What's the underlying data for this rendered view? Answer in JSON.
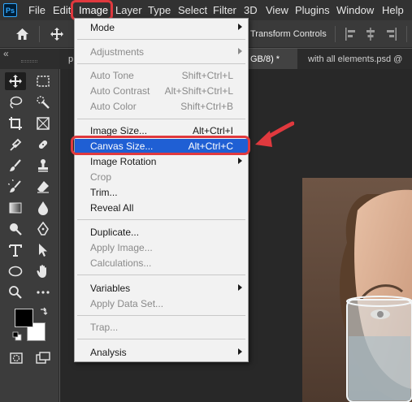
{
  "app": {
    "logo_text": "Ps"
  },
  "menubar": {
    "items": [
      "File",
      "Edit",
      "Image",
      "Layer",
      "Type",
      "Select",
      "Filter",
      "3D",
      "View",
      "Plugins",
      "Window",
      "Help"
    ],
    "active": "Image"
  },
  "options_bar": {
    "transform_label": "Transform Controls"
  },
  "tabs": [
    {
      "label": "p"
    },
    {
      "label": "GB/8) *"
    },
    {
      "label": "with all elements.psd @"
    }
  ],
  "toolbar": {
    "collapse_glyph": "«"
  },
  "image_menu": {
    "items": [
      {
        "label": "Mode",
        "shortcut": "",
        "submenu": true,
        "disabled": false
      },
      {
        "label": "Adjustments",
        "shortcut": "",
        "submenu": true,
        "disabled": true
      },
      {
        "label": "Auto Tone",
        "shortcut": "Shift+Ctrl+L",
        "submenu": false,
        "disabled": true
      },
      {
        "label": "Auto Contrast",
        "shortcut": "Alt+Shift+Ctrl+L",
        "submenu": false,
        "disabled": true
      },
      {
        "label": "Auto Color",
        "shortcut": "Shift+Ctrl+B",
        "submenu": false,
        "disabled": true
      },
      {
        "label": "Image Size...",
        "shortcut": "Alt+Ctrl+I",
        "submenu": false,
        "disabled": false
      },
      {
        "label": "Canvas Size...",
        "shortcut": "Alt+Ctrl+C",
        "submenu": false,
        "disabled": false,
        "highlighted": true
      },
      {
        "label": "Image Rotation",
        "shortcut": "",
        "submenu": true,
        "disabled": false
      },
      {
        "label": "Crop",
        "shortcut": "",
        "submenu": false,
        "disabled": true
      },
      {
        "label": "Trim...",
        "shortcut": "",
        "submenu": false,
        "disabled": false
      },
      {
        "label": "Reveal All",
        "shortcut": "",
        "submenu": false,
        "disabled": false
      },
      {
        "label": "Duplicate...",
        "shortcut": "",
        "submenu": false,
        "disabled": false
      },
      {
        "label": "Apply Image...",
        "shortcut": "",
        "submenu": false,
        "disabled": true
      },
      {
        "label": "Calculations...",
        "shortcut": "",
        "submenu": false,
        "disabled": true
      },
      {
        "label": "Variables",
        "shortcut": "",
        "submenu": true,
        "disabled": false
      },
      {
        "label": "Apply Data Set...",
        "shortcut": "",
        "submenu": false,
        "disabled": true
      },
      {
        "label": "Trap...",
        "shortcut": "",
        "submenu": false,
        "disabled": true
      },
      {
        "label": "Analysis",
        "shortcut": "",
        "submenu": true,
        "disabled": false
      }
    ]
  },
  "colors": {
    "highlight": "#1f5fd4",
    "annotation_red": "#e0393e",
    "foreground": "#000000",
    "background": "#ffffff"
  }
}
